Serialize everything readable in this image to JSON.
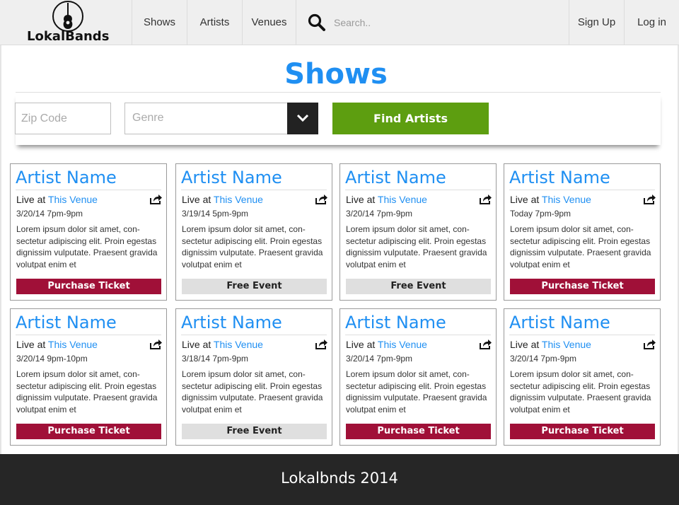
{
  "nav": {
    "logo_text": "LokalBands",
    "items": [
      {
        "label": "Shows"
      },
      {
        "label": "Artists"
      },
      {
        "label": "Venues"
      }
    ],
    "search_placeholder": "Search..",
    "signup": "Sign Up",
    "login": "Log in"
  },
  "page": {
    "title": "Shows",
    "zip_placeholder": "Zip Code",
    "genre_placeholder": "Genre",
    "find_button": "Find Artists"
  },
  "cards": [
    {
      "artist": "Artist Name",
      "live_prefix": "Live at",
      "venue": "This Venue",
      "date": "3/20/14 7pm-9pm",
      "description": "Lorem ipsum dolor sit amet, con-sectetur adipiscing elit. Proin egestas dignissim vulputate. Praesent gravida volutpat enim et",
      "button": "Purchase Ticket",
      "button_type": "purchase"
    },
    {
      "artist": "Artist Name",
      "live_prefix": "Live at",
      "venue": "This Venue",
      "date": "3/19/14 5pm-9pm",
      "description": "Lorem ipsum dolor sit amet, con-sectetur adipiscing elit. Proin egestas dignissim vulputate. Praesent gravida volutpat enim et",
      "button": "Free Event",
      "button_type": "free"
    },
    {
      "artist": "Artist Name",
      "live_prefix": "Live at",
      "venue": "This Venue",
      "date": "3/20/14 7pm-9pm",
      "description": "Lorem ipsum dolor sit amet, con-sectetur adipiscing elit. Proin egestas dignissim vulputate. Praesent gravida volutpat enim et",
      "button": "Free Event",
      "button_type": "free"
    },
    {
      "artist": "Artist Name",
      "live_prefix": "Live at",
      "venue": "This Venue",
      "date": "Today 7pm-9pm",
      "description": "Lorem ipsum dolor sit amet, con-sectetur adipiscing elit. Proin egestas dignissim vulputate. Praesent gravida volutpat enim et",
      "button": "Purchase Ticket",
      "button_type": "purchase"
    },
    {
      "artist": "Artist Name",
      "live_prefix": "Live at",
      "venue": "This Venue",
      "date": "3/20/14 9pm-10pm",
      "description": "Lorem ipsum dolor sit amet, con-sectetur adipiscing elit. Proin egestas dignissim vulputate. Praesent gravida volutpat enim et",
      "button": "Purchase Ticket",
      "button_type": "purchase"
    },
    {
      "artist": "Artist Name",
      "live_prefix": "Live at",
      "venue": "This Venue",
      "date": "3/18/14 7pm-9pm",
      "description": "Lorem ipsum dolor sit amet, con-sectetur adipiscing elit. Proin egestas dignissim vulputate. Praesent gravida volutpat enim et",
      "button": "Free Event",
      "button_type": "free"
    },
    {
      "artist": "Artist Name",
      "live_prefix": "Live at",
      "venue": "This Venue",
      "date": "3/20/14 7pm-9pm",
      "description": "Lorem ipsum dolor sit amet, con-sectetur adipiscing elit. Proin egestas dignissim vulputate. Praesent gravida volutpat enim et",
      "button": "Purchase Ticket",
      "button_type": "purchase"
    },
    {
      "artist": "Artist Name",
      "live_prefix": "Live at",
      "venue": "This Venue",
      "date": "3/20/14 7pm-9pm",
      "description": "Lorem ipsum dolor sit amet, con-sectetur adipiscing elit. Proin egestas dignissim vulputate. Praesent gravida volutpat enim et",
      "button": "Purchase Ticket",
      "button_type": "purchase"
    }
  ],
  "footer": {
    "text": "Lokalbnds 2014"
  },
  "colors": {
    "accent": "#1f8ff2",
    "find_button": "#5d9e10",
    "purchase": "#a01038",
    "free": "#dfdfdf",
    "footer": "#262626"
  },
  "icons": {
    "logo": "guitar-icon",
    "search": "search-icon",
    "dropdown": "chevron-down-icon",
    "share": "share-icon"
  }
}
